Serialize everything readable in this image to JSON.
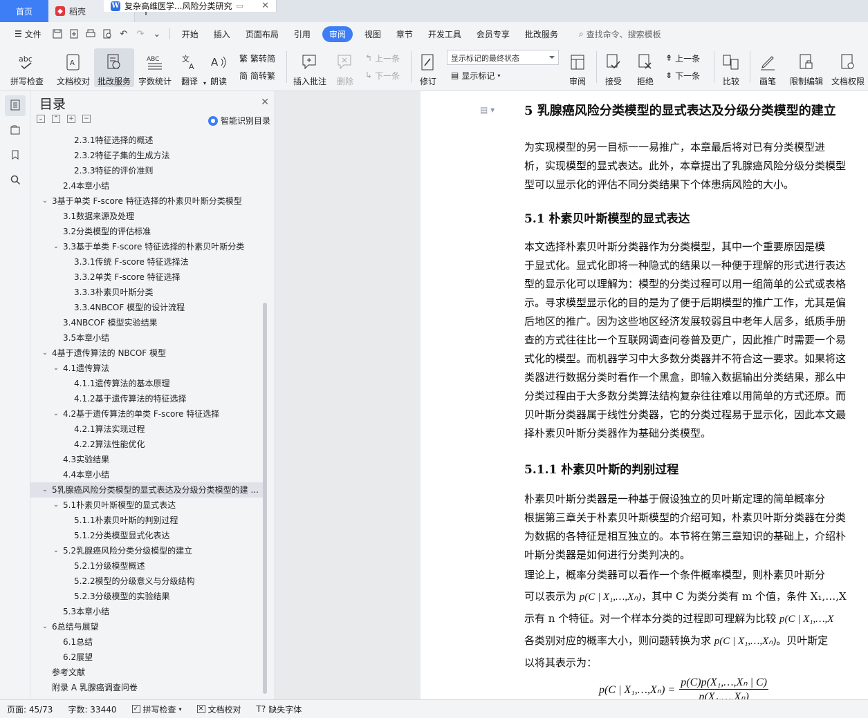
{
  "tabs": {
    "home": "首页",
    "daoke": "稻壳",
    "doc": "复杂高维医学...风险分类研究"
  },
  "menu": {
    "file": "文件",
    "items": [
      "开始",
      "插入",
      "页面布局",
      "引用",
      "审阅",
      "视图",
      "章节",
      "开发工具",
      "会员专享",
      "批改服务"
    ],
    "active": "审阅",
    "search": "查找命令、搜索模板"
  },
  "toolbar": {
    "spellcheck": "拼写检查",
    "doc_check": "文档校对",
    "review_service": "批改服务",
    "word_count": "字数统计",
    "translate": "翻译",
    "read_aloud": "朗读",
    "trad_convert": "繁转简",
    "simp_convert": "简转繁",
    "insert_comment": "插入批注",
    "delete": "删除",
    "prev": "上一条",
    "next": "下一条",
    "revise": "修订",
    "markup_select": "显示标记的最终状态",
    "show_markup": "显示标记",
    "review": "审阅",
    "accept": "接受",
    "reject": "拒绝",
    "prev2": "上一条",
    "next2": "下一条",
    "compare": "比较",
    "pen": "画笔",
    "restrict": "限制编辑",
    "doc_permission": "文档权限"
  },
  "toc": {
    "title": "目录",
    "smart": "智能识别目录",
    "items": [
      {
        "level": 3,
        "text": "2.3.1特征选择的概述",
        "chev": false
      },
      {
        "level": 3,
        "text": "2.3.2特征子集的生成方法",
        "chev": false
      },
      {
        "level": 3,
        "text": "2.3.3特征的评价准则",
        "chev": false
      },
      {
        "level": 2,
        "text": "2.4本章小结",
        "chev": false
      },
      {
        "level": 1,
        "text": "3基于单类 F-score 特征选择的朴素贝叶斯分类模型",
        "chev": true
      },
      {
        "level": 2,
        "text": "3.1数据来源及处理",
        "chev": false
      },
      {
        "level": 2,
        "text": "3.2分类模型的评估标准",
        "chev": false
      },
      {
        "level": 2,
        "text": "3.3基于单类 F-score 特征选择的朴素贝叶斯分类",
        "chev": true
      },
      {
        "level": 3,
        "text": "3.3.1传统 F-score 特征选择法",
        "chev": false
      },
      {
        "level": 3,
        "text": "3.3.2单类 F-score 特征选择",
        "chev": false
      },
      {
        "level": 3,
        "text": "3.3.3朴素贝叶斯分类",
        "chev": false
      },
      {
        "level": 3,
        "text": "3.3.4NBCOF 模型的设计流程",
        "chev": false
      },
      {
        "level": 2,
        "text": "3.4NBCOF 模型实验结果",
        "chev": false
      },
      {
        "level": 2,
        "text": "3.5本章小结",
        "chev": false
      },
      {
        "level": 1,
        "text": "4基于遗传算法的 NBCOF 模型",
        "chev": true
      },
      {
        "level": 2,
        "text": "4.1遗传算法",
        "chev": true
      },
      {
        "level": 3,
        "text": "4.1.1遗传算法的基本原理",
        "chev": false
      },
      {
        "level": 3,
        "text": "4.1.2基于遗传算法的特征选择",
        "chev": false
      },
      {
        "level": 2,
        "text": "4.2基于遗传算法的单类 F-score 特征选择",
        "chev": true
      },
      {
        "level": 3,
        "text": "4.2.1算法实现过程",
        "chev": false
      },
      {
        "level": 3,
        "text": "4.2.2算法性能优化",
        "chev": false
      },
      {
        "level": 2,
        "text": "4.3实验结果",
        "chev": false
      },
      {
        "level": 2,
        "text": "4.4本章小结",
        "chev": false
      },
      {
        "level": 1,
        "text": "5乳腺癌风险分类模型的显式表达及分级分类模型的建 ...",
        "chev": true,
        "hl": true
      },
      {
        "level": 2,
        "text": "5.1朴素贝叶斯模型的显式表达",
        "chev": true
      },
      {
        "level": 3,
        "text": "5.1.1朴素贝叶斯的判别过程",
        "chev": false
      },
      {
        "level": 3,
        "text": "5.1.2分类模型显式化表达",
        "chev": false
      },
      {
        "level": 2,
        "text": "5.2乳腺癌风险分类分级模型的建立",
        "chev": true
      },
      {
        "level": 3,
        "text": "5.2.1分级模型概述",
        "chev": false
      },
      {
        "level": 3,
        "text": "5.2.2模型的分级意义与分级结构",
        "chev": false
      },
      {
        "level": 3,
        "text": "5.2.3分级模型的实验结果",
        "chev": false
      },
      {
        "level": 2,
        "text": "5.3本章小结",
        "chev": false
      },
      {
        "level": 1,
        "text": "6总结与展望",
        "chev": true
      },
      {
        "level": 2,
        "text": "6.1总结",
        "chev": false
      },
      {
        "level": 2,
        "text": "6.2展望",
        "chev": false
      },
      {
        "level": 1,
        "text": "参考文献",
        "chev": false
      },
      {
        "level": 1,
        "text": "附录 A 乳腺癌调查问卷",
        "chev": false
      }
    ]
  },
  "doc": {
    "h1": "5  乳腺癌风险分类模型的显式表达及分级分类模型的建立",
    "p1": [
      "    为实现模型的另一目标一一易推广，本章最后将对已有分类模型进",
      "析，实现模型的显式表达。此外，本章提出了乳腺癌风险分级分类模型",
      "型可以显示化的评估不同分类结果下个体患病风险的大小。"
    ],
    "h2_1": "5.1  朴素贝叶斯模型的显式表达",
    "p2": [
      "    本文选择朴素贝叶斯分类器作为分类模型，其中一个重要原因是模",
      "于显式化。显式化即将一种隐式的结果以一种便于理解的形式进行表达",
      "型的显示化可以理解为：模型的分类过程可以用一组简单的公式或表格",
      "示。寻求模型显示化的目的是为了便于后期模型的推广工作，尤其是偏",
      "后地区的推广。因为这些地区经济发展较弱且中老年人居多，纸质手册",
      "查的方式往往比一个互联网调查问卷普及更广，因此推广时需要一个易",
      "式化的模型。而机器学习中大多数分类器并不符合这一要求。如果将这",
      "类器进行数据分类时看作一个黑盒，即输入数据输出分类结果，那么中",
      "分类过程由于大多数分类算法结构复杂往往难以用简单的方式还原。而",
      "贝叶斯分类器属于线性分类器，它的分类过程易于显示化，因此本文最",
      "择朴素贝叶斯分类器作为基础分类模型。"
    ],
    "h2_2": "5.1.1  朴素贝叶斯的判别过程",
    "p3": [
      "    朴素贝叶斯分类器是一种基于假设独立的贝叶斯定理的简单概率分",
      "根据第三章关于朴素贝叶斯模型的介绍可知，朴素贝叶斯分类器在分类",
      "为数据的各特征是相互独立的。本节将在第三章知识的基础上，介绍朴",
      "叶斯分类器是如何进行分类判决的。"
    ],
    "p4_1": "    理论上，概率分类器可以看作一个条件概率模型，则朴素贝叶斯分",
    "p4_2a": "可以表示为 ",
    "p4_2m": "p(C | X₁,…,Xₙ)",
    "p4_2b": "，其中 C 为类分类有 m 个值，条件 X₁,…,X",
    "p4_3a": "示有 n 个特征。对一个样本分类的过程即可理解为比较 ",
    "p4_3m": "p(C | X₁,…,X",
    "p4_4a": "各类别对应的概率大小，则问题转换为求 ",
    "p4_4m": "p(C | X₁,…,Xₙ)",
    "p4_4b": "。贝叶斯定",
    "p4_5": "以将其表示为：",
    "formula_lhs": "p(C | X₁,…,Xₙ) =",
    "formula_num": "p(C)p(X₁,…,Xₙ | C)",
    "formula_den": "p(X₁,…,Xₙ)"
  },
  "status": {
    "page": "页面: 45/73",
    "words": "字数: 33440",
    "spell": "拼写检查",
    "proof": "文档校对",
    "missing_font": "缺失字体"
  }
}
